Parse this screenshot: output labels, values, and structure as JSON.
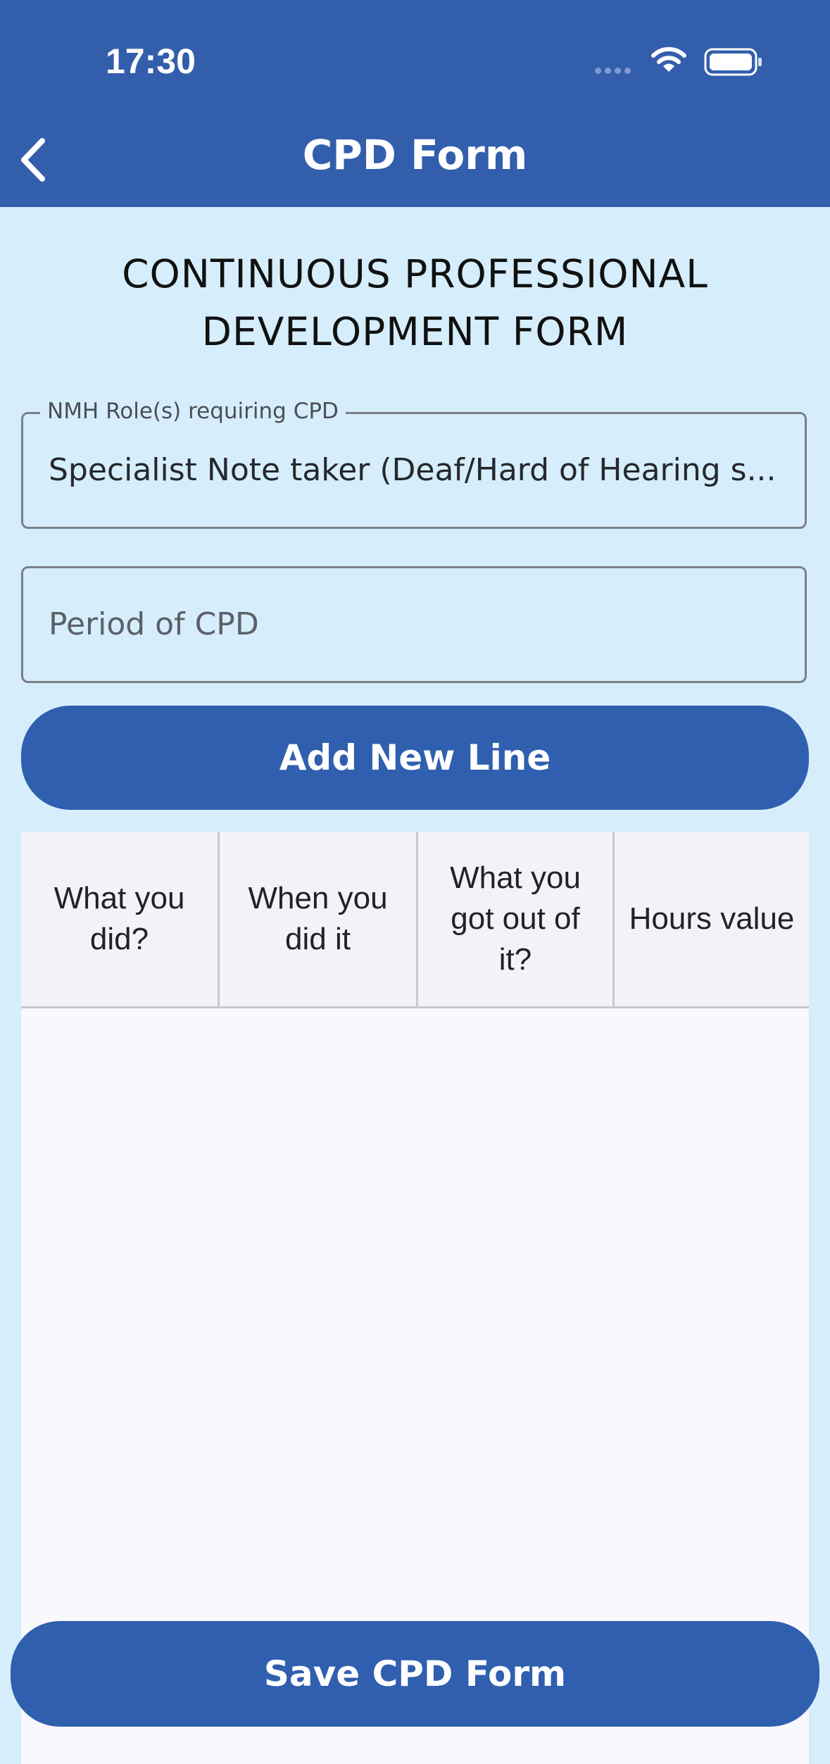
{
  "status_bar": {
    "time": "17:30"
  },
  "nav": {
    "title": "CPD Form",
    "back_icon": "chevron-left-icon"
  },
  "form": {
    "heading_line1": "CONTINUOUS PROFESSIONAL",
    "heading_line2": "DEVELOPMENT FORM",
    "role_field": {
      "label": "NMH Role(s) requiring CPD",
      "value": "Specialist Note taker (Deaf/Hard of Hearing s..."
    },
    "period_field": {
      "placeholder": "Period of CPD"
    }
  },
  "buttons": {
    "add_line": "Add New Line",
    "save": "Save CPD Form"
  },
  "table": {
    "columns": [
      "What you did?",
      "When you did it",
      "What you got out of it?",
      "Hours value"
    ],
    "rows": []
  },
  "colors": {
    "primary": "#335eac",
    "background": "#d6eefb",
    "table_bg": "#f8f8fd"
  }
}
